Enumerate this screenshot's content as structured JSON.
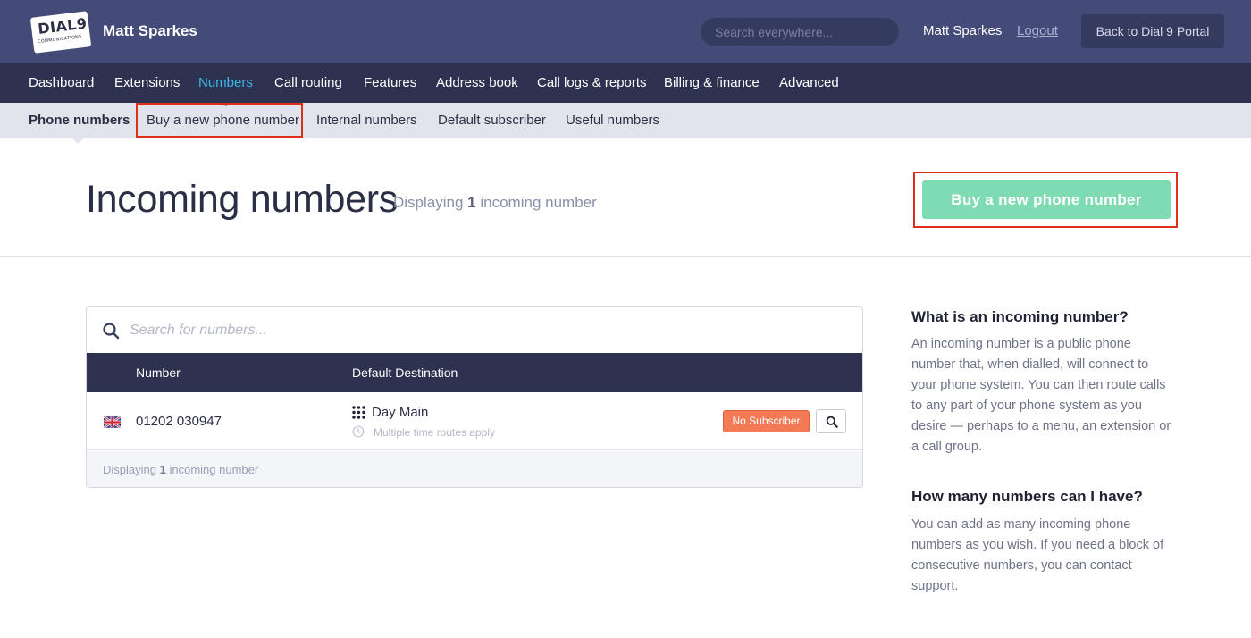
{
  "header": {
    "logo_text": "DIAL9",
    "logo_subtext": "COMMUNICATIONS",
    "account_name": "Matt Sparkes",
    "search_placeholder": "Search everywhere...",
    "user_name": "Matt Sparkes",
    "logout_label": "Logout",
    "portal_button_label": "Back to Dial 9 Portal"
  },
  "main_nav": {
    "items": [
      {
        "label": "Dashboard"
      },
      {
        "label": "Extensions"
      },
      {
        "label": "Numbers",
        "active": true
      },
      {
        "label": "Call routing"
      },
      {
        "label": "Features"
      },
      {
        "label": "Address book"
      },
      {
        "label": "Call logs & reports"
      },
      {
        "label": "Billing & finance"
      },
      {
        "label": "Advanced"
      }
    ]
  },
  "sub_nav": {
    "items": [
      {
        "label": "Phone numbers",
        "active": true
      },
      {
        "label": "Buy a new phone number"
      },
      {
        "label": "Internal numbers"
      },
      {
        "label": "Default subscriber"
      },
      {
        "label": "Useful numbers"
      }
    ]
  },
  "page": {
    "title": "Incoming numbers",
    "subtitle_prefix": "Displaying",
    "subtitle_count": "1",
    "subtitle_suffix": "incoming number",
    "cta_label": "Buy a new phone number"
  },
  "numbers_table": {
    "search_placeholder": "Search for numbers...",
    "columns": [
      "Number",
      "Default Destination"
    ],
    "rows": [
      {
        "flag": "uk-flag-icon",
        "number": "01202 030947",
        "destination": "Day Main",
        "destination_note": "Multiple time routes apply",
        "status": "No Subscriber"
      }
    ],
    "footer_prefix": "Displaying",
    "footer_count": "1",
    "footer_suffix": "incoming number"
  },
  "help": [
    {
      "heading": "What is an incoming number?",
      "text": "An incoming number is a public phone number that, when dialled, will connect to your phone system. You can then route calls to any part of your phone system as you desire — perhaps to a menu, an extension or a call group."
    },
    {
      "heading": "How many numbers can I have?",
      "text": "You can add as many incoming phone numbers as you wish. If you need a block of consecutive numbers, you can contact support."
    }
  ],
  "colors": {
    "header_bg": "#454b78",
    "nav_bg": "#2e3251",
    "active_nav": "#39b7e6",
    "cta": "#7fdcb2",
    "badge": "#f47a55",
    "highlight": "#e02e1a"
  }
}
